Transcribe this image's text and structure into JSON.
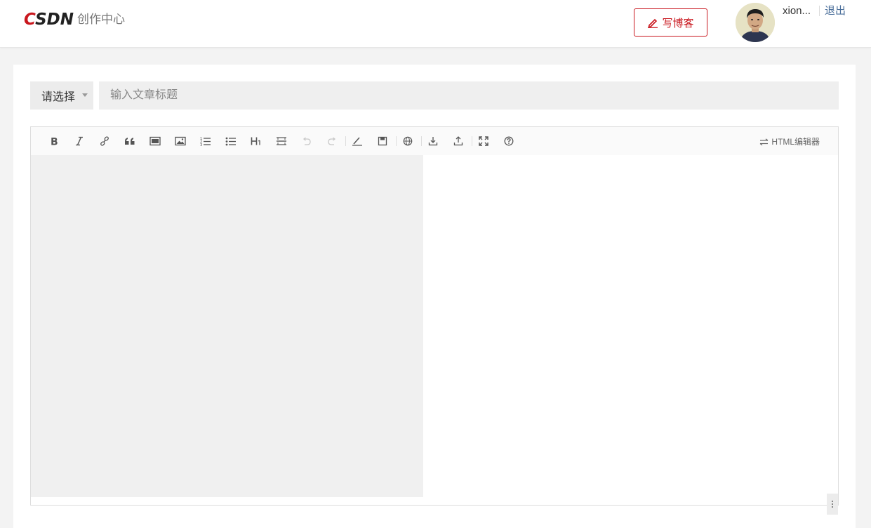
{
  "header": {
    "logo_mark_c": "C",
    "logo_mark_rest": "SDN",
    "logo_sub": "创作中心",
    "write_button_label": "写博客",
    "username": "xion...",
    "logout_label": "退出",
    "accent_color": "#c9171e"
  },
  "form": {
    "category_select_value": "请选择",
    "title_placeholder": "输入文章标题"
  },
  "toolbar": {
    "buttons": [
      {
        "icon": "bold-icon"
      },
      {
        "icon": "italic-icon"
      },
      {
        "icon": "link-icon"
      },
      {
        "icon": "quote-icon"
      },
      {
        "icon": "code-icon"
      },
      {
        "icon": "image-icon"
      },
      {
        "icon": "ordered-list-icon"
      },
      {
        "icon": "unordered-list-icon"
      },
      {
        "icon": "heading-icon"
      },
      {
        "icon": "horizontal-rule-icon"
      },
      {
        "icon": "undo-icon",
        "disabled": true
      },
      {
        "icon": "redo-icon",
        "disabled": true
      },
      {
        "icon": "clear-format-icon"
      },
      {
        "icon": "save-icon"
      },
      {
        "icon": "globe-icon"
      },
      {
        "icon": "download-icon"
      },
      {
        "icon": "upload-icon"
      },
      {
        "icon": "fullscreen-icon"
      },
      {
        "icon": "help-icon"
      }
    ],
    "html_editor_label": "HTML编辑器"
  }
}
